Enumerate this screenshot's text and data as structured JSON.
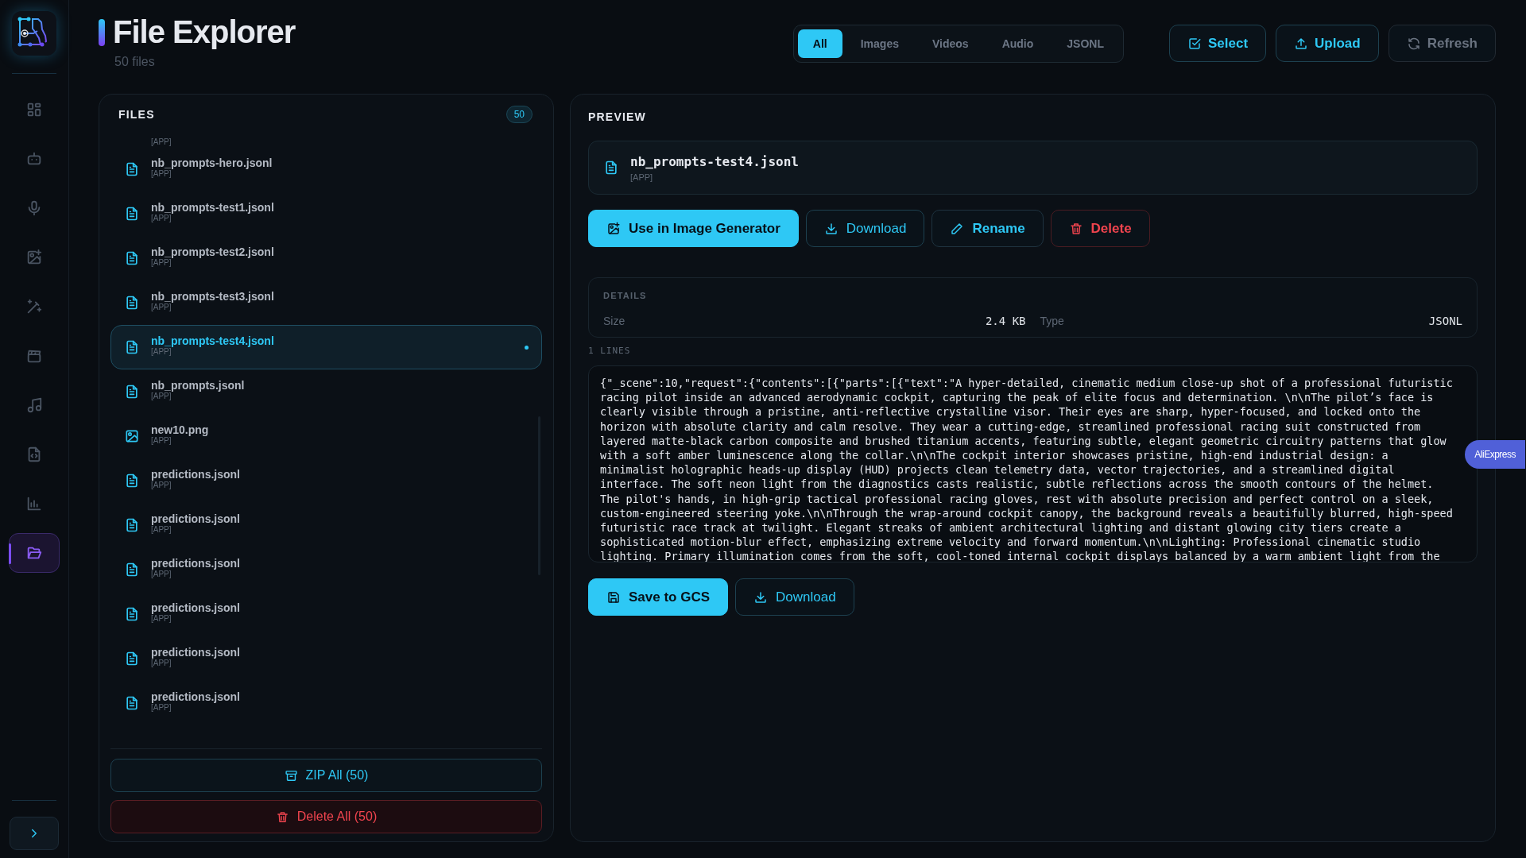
{
  "sidebar": {
    "items": [
      {
        "selected": false
      },
      {
        "selected": false
      },
      {
        "selected": false
      },
      {
        "selected": false
      },
      {
        "selected": false
      },
      {
        "selected": false
      },
      {
        "selected": false
      },
      {
        "selected": false
      },
      {
        "selected": false
      },
      {
        "selected": true
      }
    ]
  },
  "header": {
    "title": "File Explorer",
    "subtitle": "50 files"
  },
  "filter_tabs": [
    {
      "label": "All",
      "selected": true
    },
    {
      "label": "Images",
      "selected": false
    },
    {
      "label": "Videos",
      "selected": false
    },
    {
      "label": "Audio",
      "selected": false
    },
    {
      "label": "JSONL",
      "selected": false
    }
  ],
  "toolbar": [
    {
      "label": "Select",
      "disabled": false
    },
    {
      "label": "Upload",
      "disabled": false
    },
    {
      "label": "Refresh",
      "disabled": true
    }
  ],
  "files": {
    "title": "FILES",
    "count": "50",
    "items": [
      {
        "kind": "partial",
        "source": "[APP]",
        "selected": false
      },
      {
        "kind": "document",
        "name": "nb_prompts-hero.jsonl",
        "source": "[APP]",
        "selected": false
      },
      {
        "kind": "document",
        "name": "nb_prompts-test1.jsonl",
        "source": "[APP]",
        "selected": false
      },
      {
        "kind": "document",
        "name": "nb_prompts-test2.jsonl",
        "source": "[APP]",
        "selected": false
      },
      {
        "kind": "document",
        "name": "nb_prompts-test3.jsonl",
        "source": "[APP]",
        "selected": false
      },
      {
        "kind": "document",
        "name": "nb_prompts-test4.jsonl",
        "source": "[APP]",
        "selected": true
      },
      {
        "kind": "document",
        "name": "nb_prompts.jsonl",
        "source": "[APP]",
        "selected": false
      },
      {
        "kind": "image",
        "name": "new10.png",
        "source": "[APP]",
        "selected": false
      },
      {
        "kind": "document",
        "name": "predictions.jsonl",
        "source": "[APP]",
        "selected": false
      },
      {
        "kind": "document",
        "name": "predictions.jsonl",
        "source": "[APP]",
        "selected": false
      },
      {
        "kind": "document",
        "name": "predictions.jsonl",
        "source": "[APP]",
        "selected": false
      },
      {
        "kind": "document",
        "name": "predictions.jsonl",
        "source": "[APP]",
        "selected": false
      },
      {
        "kind": "document",
        "name": "predictions.jsonl",
        "source": "[APP]",
        "selected": false
      },
      {
        "kind": "document",
        "name": "predictions.jsonl",
        "source": "[APP]",
        "selected": false
      }
    ],
    "buttons": [
      {
        "kind": "zip",
        "label": "ZIP All (50)"
      },
      {
        "kind": "danger",
        "label": "Delete All (50)"
      }
    ]
  },
  "preview": {
    "title": "PREVIEW",
    "file_name": "nb_prompts-test4.jsonl",
    "source": "[APP]",
    "actions": [
      {
        "kind": "primary",
        "label": "Use in Image Generator"
      },
      {
        "kind": "download",
        "label": "Download"
      },
      {
        "kind": "rename",
        "label": "Rename"
      },
      {
        "kind": "danger",
        "label": "Delete"
      }
    ],
    "details": {
      "title": "DETAILS",
      "size_label": "Size",
      "size": "2.4 KB",
      "type_label": "Type",
      "type": "JSONL"
    },
    "lines_label": "1 LINES",
    "content_lines": [
      "{\"_scene\":10,\"request\":{\"contents\":[{\"parts\":[{\"text\":\"A hyper-detailed, cinematic medium close-up shot of a professional futuristic",
      "racing pilot inside an advanced aerodynamic cockpit, capturing the peak of elite focus and determination. \\n\\nThe pilot’s face is",
      "clearly visible through a pristine, anti-reflective crystalline visor. Their eyes are sharp, hyper-focused, and locked onto the",
      "horizon with absolute clarity and calm resolve. They wear a cutting-edge, streamlined professional racing suit constructed from",
      "layered matte-black carbon composite and brushed titanium accents, featuring subtle, elegant geometric circuitry patterns that glow",
      "with a soft amber luminescence along the collar.\\n\\nThe cockpit interior showcases pristine, high-end industrial design: a",
      "minimalist holographic heads-up display (HUD) projects clean telemetry data, vector trajectories, and a streamlined digital",
      "interface. The soft neon light from the diagnostics casts realistic, subtle reflections across the smooth contours of the helmet.",
      "The pilot's hands, in high-grip tactical professional racing gloves, rest with absolute precision and perfect control on a sleek,",
      "custom-engineered steering yoke.\\n\\nThrough the wrap-around cockpit canopy, the background reveals a beautifully blurred, high-speed",
      "futuristic race track at twilight. Elegant streaks of ambient architectural lighting and distant glowing city tiers create a",
      "sophisticated motion-blur effect, emphasizing extreme velocity and forward momentum.\\n\\nLighting: Professional cinematic studio",
      "lighting. Primary illumination comes from the soft, cool-toned internal cockpit displays balanced by a warm ambient light from the"
    ],
    "bottom_actions": [
      {
        "kind": "primary",
        "label": "Save to GCS"
      },
      {
        "kind": "download",
        "label": "Download"
      }
    ]
  },
  "extension_tab": {
    "label": "AliExpress"
  }
}
